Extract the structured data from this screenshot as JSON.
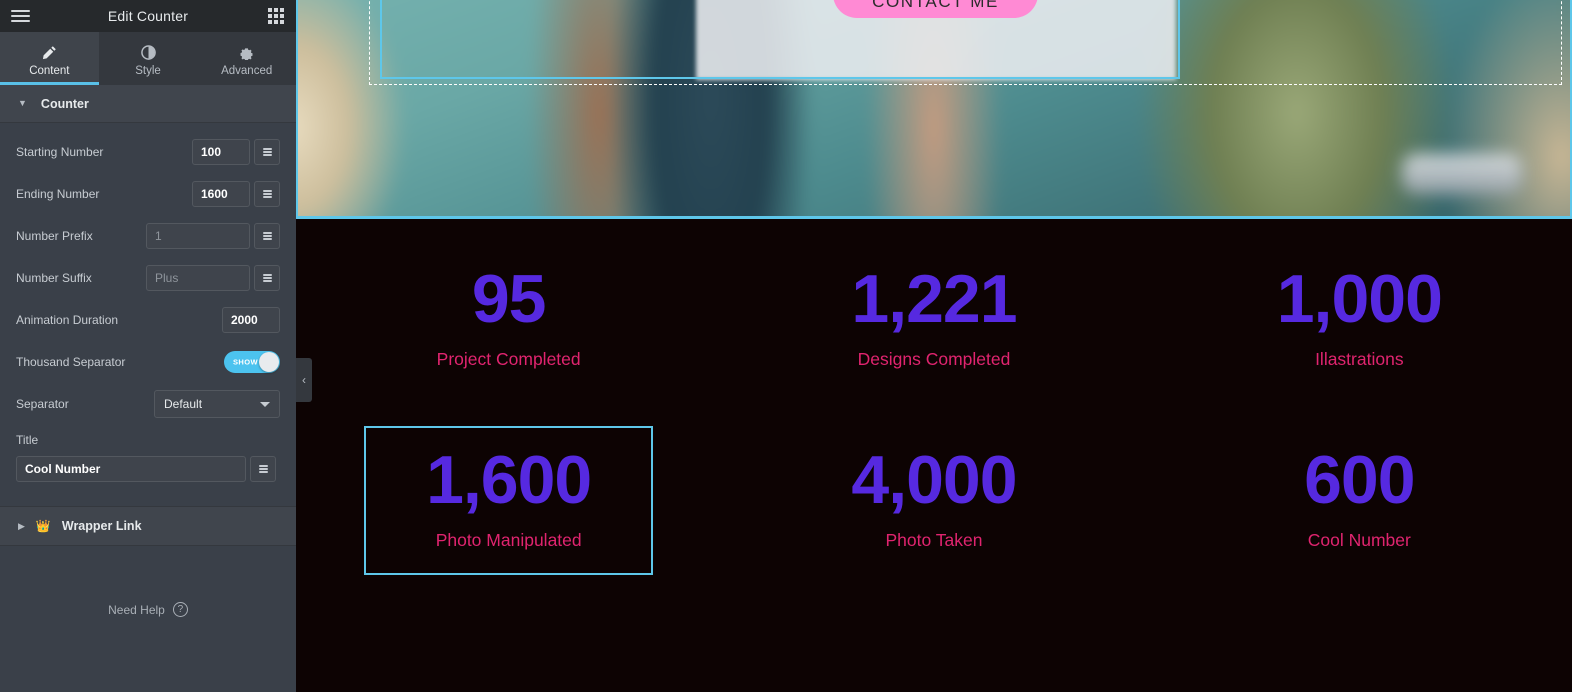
{
  "panel": {
    "header": {
      "title": "Edit Counter",
      "menu_icon": "hamburger-icon",
      "widgets_icon": "grid-icon"
    },
    "tabs": [
      {
        "id": "content",
        "label": "Content",
        "icon": "pencil-icon",
        "active": true
      },
      {
        "id": "style",
        "label": "Style",
        "icon": "contrast-icon",
        "active": false
      },
      {
        "id": "advanced",
        "label": "Advanced",
        "icon": "gear-icon",
        "active": false
      }
    ],
    "section": {
      "label": "Counter",
      "caret": "▼"
    },
    "fields": {
      "starting_number": {
        "label": "Starting Number",
        "value": "100",
        "placeholder": ""
      },
      "ending_number": {
        "label": "Ending Number",
        "value": "1600",
        "placeholder": ""
      },
      "number_prefix": {
        "label": "Number Prefix",
        "value": "",
        "placeholder": "1"
      },
      "number_suffix": {
        "label": "Number Suffix",
        "value": "",
        "placeholder": "Plus"
      },
      "animation_duration": {
        "label": "Animation Duration",
        "value": "2000",
        "placeholder": ""
      },
      "thousand_separator": {
        "label": "Thousand Separator",
        "toggle_label": "SHOW",
        "state": "on"
      },
      "separator": {
        "label": "Separator",
        "value": "Default"
      },
      "title": {
        "label": "Title",
        "value": "Cool Number",
        "placeholder": ""
      }
    },
    "wrapper_link": {
      "label": "Wrapper Link",
      "pro_icon": "👑",
      "caret": "▶"
    },
    "need_help": {
      "label": "Need Help",
      "icon": "question-mark-icon",
      "glyph": "?"
    },
    "collapse_tab": {
      "icon": "chevron-left-icon",
      "glyph": "‹"
    },
    "colors": {
      "accent_cyan": "#59c0e8",
      "panel_bg": "#3a4049",
      "header_bg": "#26292c"
    }
  },
  "preview": {
    "hero": {
      "cta_label": "CONTACT ME",
      "cta_color": "#ff8ad4",
      "selection_color": "#5ec7ea"
    },
    "counters": {
      "number_color": "#5629e0",
      "caption_color": "#e0246f",
      "background": "#0d0303",
      "rows": [
        [
          {
            "number": "95",
            "caption": "Project Completed",
            "selected": false
          },
          {
            "number": "1,221",
            "caption": "Designs Completed",
            "selected": false
          },
          {
            "number": "1,000",
            "caption": "Illastrations",
            "selected": false
          }
        ],
        [
          {
            "number": "1,600",
            "caption": "Photo Manipulated",
            "selected": true
          },
          {
            "number": "4,000",
            "caption": "Photo Taken",
            "selected": false
          },
          {
            "number": "600",
            "caption": "Cool Number",
            "selected": false
          }
        ]
      ]
    }
  }
}
